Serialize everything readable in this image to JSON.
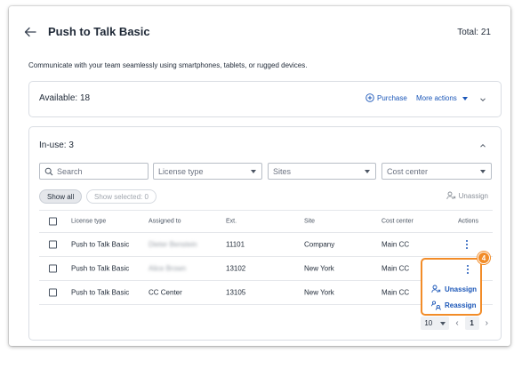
{
  "header": {
    "title": "Push to Talk Basic",
    "total": "Total: 21",
    "description": "Communicate with your team seamlessly using smartphones, tablets, or rugged devices."
  },
  "available": {
    "label": "Available: 18",
    "purchase_label": "Purchase",
    "more_actions_label": "More actions"
  },
  "in_use": {
    "label": "In-use: 3",
    "filters": {
      "search_placeholder": "Search",
      "license_type": "License type",
      "sites": "Sites",
      "cost_center": "Cost center"
    },
    "show_all_label": "Show all",
    "show_selected_label": "Show selected: 0",
    "unassign_label": "Unassign",
    "columns": [
      "License type",
      "Assigned to",
      "Ext.",
      "Site",
      "Cost center",
      "Actions"
    ],
    "rows": [
      {
        "license_type": "Push to Talk Basic",
        "assigned_to": "Dieter Benstein",
        "ext": "11101",
        "site": "Company",
        "cost_center": "Main CC"
      },
      {
        "license_type": "Push to Talk Basic",
        "assigned_to": "Alice Brown",
        "ext": "13102",
        "site": "New York",
        "cost_center": "Main CC"
      },
      {
        "license_type": "Push to Talk Basic",
        "assigned_to": "CC Center",
        "ext": "13105",
        "site": "New York",
        "cost_center": "Main CC"
      }
    ],
    "pagination": {
      "page_size": "10",
      "current_page": "1"
    }
  },
  "popup_menu": {
    "badge": "4",
    "items": [
      "Unassign",
      "Reassign"
    ]
  },
  "colors": {
    "accent": "#1a56b8",
    "highlight": "#f28c28"
  }
}
